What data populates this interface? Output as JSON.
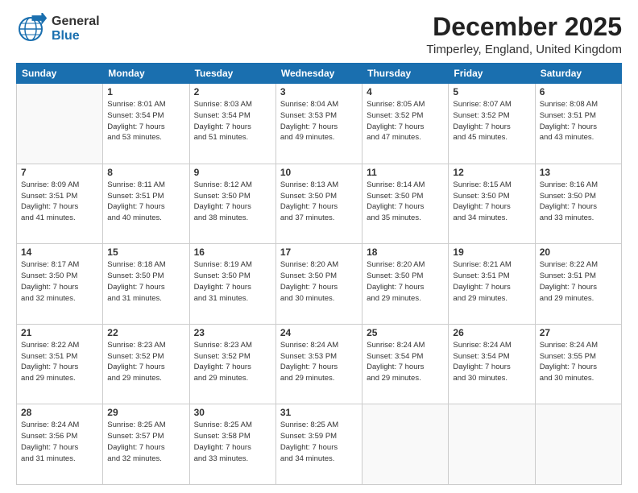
{
  "logo": {
    "general": "General",
    "blue": "Blue"
  },
  "header": {
    "month": "December 2025",
    "location": "Timperley, England, United Kingdom"
  },
  "weekdays": [
    "Sunday",
    "Monday",
    "Tuesday",
    "Wednesday",
    "Thursday",
    "Friday",
    "Saturday"
  ],
  "weeks": [
    [
      {
        "day": "",
        "sunrise": "",
        "sunset": "",
        "daylight": ""
      },
      {
        "day": "1",
        "sunrise": "Sunrise: 8:01 AM",
        "sunset": "Sunset: 3:54 PM",
        "daylight": "Daylight: 7 hours",
        "daylight2": "and 53 minutes."
      },
      {
        "day": "2",
        "sunrise": "Sunrise: 8:03 AM",
        "sunset": "Sunset: 3:54 PM",
        "daylight": "Daylight: 7 hours",
        "daylight2": "and 51 minutes."
      },
      {
        "day": "3",
        "sunrise": "Sunrise: 8:04 AM",
        "sunset": "Sunset: 3:53 PM",
        "daylight": "Daylight: 7 hours",
        "daylight2": "and 49 minutes."
      },
      {
        "day": "4",
        "sunrise": "Sunrise: 8:05 AM",
        "sunset": "Sunset: 3:52 PM",
        "daylight": "Daylight: 7 hours",
        "daylight2": "and 47 minutes."
      },
      {
        "day": "5",
        "sunrise": "Sunrise: 8:07 AM",
        "sunset": "Sunset: 3:52 PM",
        "daylight": "Daylight: 7 hours",
        "daylight2": "and 45 minutes."
      },
      {
        "day": "6",
        "sunrise": "Sunrise: 8:08 AM",
        "sunset": "Sunset: 3:51 PM",
        "daylight": "Daylight: 7 hours",
        "daylight2": "and 43 minutes."
      }
    ],
    [
      {
        "day": "7",
        "sunrise": "Sunrise: 8:09 AM",
        "sunset": "Sunset: 3:51 PM",
        "daylight": "Daylight: 7 hours",
        "daylight2": "and 41 minutes."
      },
      {
        "day": "8",
        "sunrise": "Sunrise: 8:11 AM",
        "sunset": "Sunset: 3:51 PM",
        "daylight": "Daylight: 7 hours",
        "daylight2": "and 40 minutes."
      },
      {
        "day": "9",
        "sunrise": "Sunrise: 8:12 AM",
        "sunset": "Sunset: 3:50 PM",
        "daylight": "Daylight: 7 hours",
        "daylight2": "and 38 minutes."
      },
      {
        "day": "10",
        "sunrise": "Sunrise: 8:13 AM",
        "sunset": "Sunset: 3:50 PM",
        "daylight": "Daylight: 7 hours",
        "daylight2": "and 37 minutes."
      },
      {
        "day": "11",
        "sunrise": "Sunrise: 8:14 AM",
        "sunset": "Sunset: 3:50 PM",
        "daylight": "Daylight: 7 hours",
        "daylight2": "and 35 minutes."
      },
      {
        "day": "12",
        "sunrise": "Sunrise: 8:15 AM",
        "sunset": "Sunset: 3:50 PM",
        "daylight": "Daylight: 7 hours",
        "daylight2": "and 34 minutes."
      },
      {
        "day": "13",
        "sunrise": "Sunrise: 8:16 AM",
        "sunset": "Sunset: 3:50 PM",
        "daylight": "Daylight: 7 hours",
        "daylight2": "and 33 minutes."
      }
    ],
    [
      {
        "day": "14",
        "sunrise": "Sunrise: 8:17 AM",
        "sunset": "Sunset: 3:50 PM",
        "daylight": "Daylight: 7 hours",
        "daylight2": "and 32 minutes."
      },
      {
        "day": "15",
        "sunrise": "Sunrise: 8:18 AM",
        "sunset": "Sunset: 3:50 PM",
        "daylight": "Daylight: 7 hours",
        "daylight2": "and 31 minutes."
      },
      {
        "day": "16",
        "sunrise": "Sunrise: 8:19 AM",
        "sunset": "Sunset: 3:50 PM",
        "daylight": "Daylight: 7 hours",
        "daylight2": "and 31 minutes."
      },
      {
        "day": "17",
        "sunrise": "Sunrise: 8:20 AM",
        "sunset": "Sunset: 3:50 PM",
        "daylight": "Daylight: 7 hours",
        "daylight2": "and 30 minutes."
      },
      {
        "day": "18",
        "sunrise": "Sunrise: 8:20 AM",
        "sunset": "Sunset: 3:50 PM",
        "daylight": "Daylight: 7 hours",
        "daylight2": "and 29 minutes."
      },
      {
        "day": "19",
        "sunrise": "Sunrise: 8:21 AM",
        "sunset": "Sunset: 3:51 PM",
        "daylight": "Daylight: 7 hours",
        "daylight2": "and 29 minutes."
      },
      {
        "day": "20",
        "sunrise": "Sunrise: 8:22 AM",
        "sunset": "Sunset: 3:51 PM",
        "daylight": "Daylight: 7 hours",
        "daylight2": "and 29 minutes."
      }
    ],
    [
      {
        "day": "21",
        "sunrise": "Sunrise: 8:22 AM",
        "sunset": "Sunset: 3:51 PM",
        "daylight": "Daylight: 7 hours",
        "daylight2": "and 29 minutes."
      },
      {
        "day": "22",
        "sunrise": "Sunrise: 8:23 AM",
        "sunset": "Sunset: 3:52 PM",
        "daylight": "Daylight: 7 hours",
        "daylight2": "and 29 minutes."
      },
      {
        "day": "23",
        "sunrise": "Sunrise: 8:23 AM",
        "sunset": "Sunset: 3:52 PM",
        "daylight": "Daylight: 7 hours",
        "daylight2": "and 29 minutes."
      },
      {
        "day": "24",
        "sunrise": "Sunrise: 8:24 AM",
        "sunset": "Sunset: 3:53 PM",
        "daylight": "Daylight: 7 hours",
        "daylight2": "and 29 minutes."
      },
      {
        "day": "25",
        "sunrise": "Sunrise: 8:24 AM",
        "sunset": "Sunset: 3:54 PM",
        "daylight": "Daylight: 7 hours",
        "daylight2": "and 29 minutes."
      },
      {
        "day": "26",
        "sunrise": "Sunrise: 8:24 AM",
        "sunset": "Sunset: 3:54 PM",
        "daylight": "Daylight: 7 hours",
        "daylight2": "and 30 minutes."
      },
      {
        "day": "27",
        "sunrise": "Sunrise: 8:24 AM",
        "sunset": "Sunset: 3:55 PM",
        "daylight": "Daylight: 7 hours",
        "daylight2": "and 30 minutes."
      }
    ],
    [
      {
        "day": "28",
        "sunrise": "Sunrise: 8:24 AM",
        "sunset": "Sunset: 3:56 PM",
        "daylight": "Daylight: 7 hours",
        "daylight2": "and 31 minutes."
      },
      {
        "day": "29",
        "sunrise": "Sunrise: 8:25 AM",
        "sunset": "Sunset: 3:57 PM",
        "daylight": "Daylight: 7 hours",
        "daylight2": "and 32 minutes."
      },
      {
        "day": "30",
        "sunrise": "Sunrise: 8:25 AM",
        "sunset": "Sunset: 3:58 PM",
        "daylight": "Daylight: 7 hours",
        "daylight2": "and 33 minutes."
      },
      {
        "day": "31",
        "sunrise": "Sunrise: 8:25 AM",
        "sunset": "Sunset: 3:59 PM",
        "daylight": "Daylight: 7 hours",
        "daylight2": "and 34 minutes."
      },
      {
        "day": "",
        "sunrise": "",
        "sunset": "",
        "daylight": ""
      },
      {
        "day": "",
        "sunrise": "",
        "sunset": "",
        "daylight": ""
      },
      {
        "day": "",
        "sunrise": "",
        "sunset": "",
        "daylight": ""
      }
    ]
  ]
}
